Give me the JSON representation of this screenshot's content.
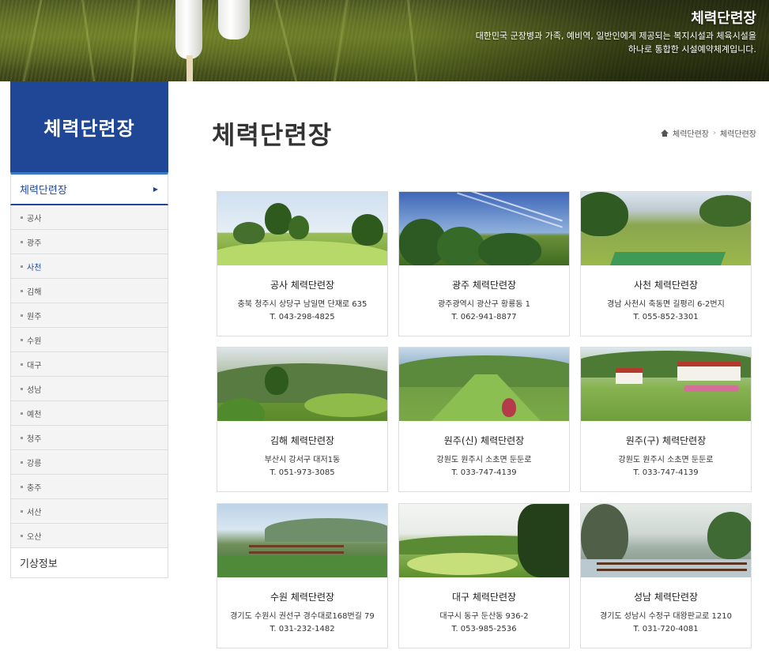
{
  "banner": {
    "title": "체력단련장",
    "desc_line1": "대한민국 군장병과 가족, 예비역, 일반인에게 제공되는 복지시설과 체육시설을",
    "desc_line2": "하나로 통합한 시설예약체계입니다."
  },
  "sidebar": {
    "heading": "체력단련장",
    "active_item": "체력단련장",
    "sub_items": [
      "공사",
      "광주",
      "사천",
      "김해",
      "원주",
      "수원",
      "대구",
      "성남",
      "예천",
      "청주",
      "강릉",
      "충주",
      "서산",
      "오산"
    ],
    "current_sub": "사천",
    "weather": "기상정보"
  },
  "page": {
    "title": "체력단련장",
    "breadcrumb": [
      "체력단련장",
      "체력단련장"
    ]
  },
  "facilities": [
    {
      "name": "공사 체력단련장",
      "address": "충북 청주시 상당구 남일면 단재로 635",
      "tel": "T. 043-298-4825"
    },
    {
      "name": "광주 체력단련장",
      "address": "광주광역시 광산구 황룡동 1",
      "tel": "T. 062-941-8877"
    },
    {
      "name": "사천 체력단련장",
      "address": "경남 사천시 축동면 길평리 6-2번지",
      "tel": "T. 055-852-3301"
    },
    {
      "name": "김해 체력단련장",
      "address": "부산시 강서구 대저1동",
      "tel": "T. 051-973-3085"
    },
    {
      "name": "원주(신) 체력단련장",
      "address": "강원도 원주시 소초면 둔둔로",
      "tel": "T. 033-747-4139"
    },
    {
      "name": "원주(구) 체력단련장",
      "address": "강원도 원주시 소초면 둔둔로",
      "tel": "T. 033-747-4139"
    },
    {
      "name": "수원 체력단련장",
      "address": "경기도 수원시 권선구 경수대로168번길 79",
      "tel": "T. 031-232-1482"
    },
    {
      "name": "대구 체력단련장",
      "address": "대구시 동구 둔산동 936-2",
      "tel": "T. 053-985-2536"
    },
    {
      "name": "성남 체력단련장",
      "address": "경기도 성남시 수정구 대왕판교로 1210",
      "tel": "T. 031-720-4081"
    }
  ],
  "colors": {
    "brand_blue": "#1f4795",
    "accent_blue": "#3a78c9"
  }
}
